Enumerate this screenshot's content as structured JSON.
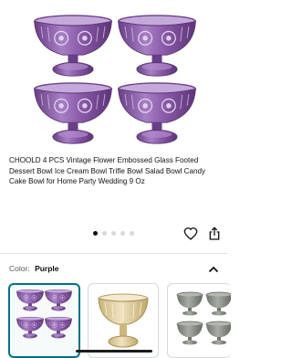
{
  "product": {
    "title": "CHOOLD 4 PCS Vintage Flower Embossed Glass Footed Dessert Bowl Ice Cream Bowl Trifle Bowl Salad Bowl Candy Cake Bowl for Home Party Wedding 9 Oz"
  },
  "gallery": {
    "image_count": 5,
    "active_index": 0,
    "bowl_color": "#8a5aa8"
  },
  "actions": {
    "favorite_icon": "heart-icon",
    "share_icon": "share-icon"
  },
  "variation": {
    "label": "Color:",
    "selected": "Purple",
    "toggle_icon": "chevron-up-icon",
    "swatches": [
      {
        "name": "purple",
        "color": "#8a5aa8"
      },
      {
        "name": "amber",
        "color": "#d8c79a"
      },
      {
        "name": "gray",
        "color": "#8a8f88"
      }
    ]
  },
  "colors": {
    "accent": "#007185",
    "text": "#0f1111",
    "muted": "#565959"
  }
}
